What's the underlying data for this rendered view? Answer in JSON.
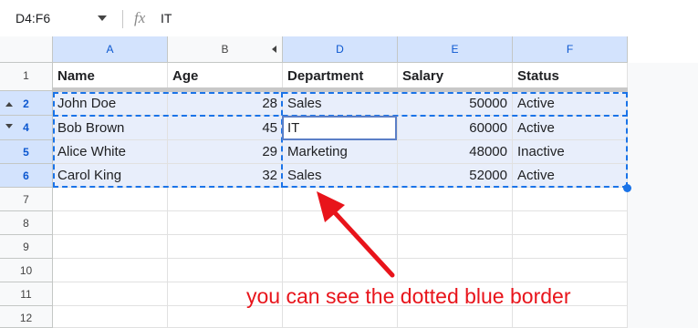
{
  "formula_bar": {
    "name_box": "D4:F6",
    "fx_label": "fx",
    "value": "IT"
  },
  "columns": [
    "A",
    "B",
    "D",
    "E",
    "F"
  ],
  "rows": [
    "1",
    "2",
    "4",
    "5",
    "6",
    "7",
    "8",
    "9",
    "10",
    "11",
    "12"
  ],
  "headers": [
    "Name",
    "Age",
    "Department",
    "Salary",
    "Status"
  ],
  "data": [
    [
      "John Doe",
      "28",
      "Sales",
      "50000",
      "Active"
    ],
    [
      "Bob Brown",
      "45",
      "IT",
      "60000",
      "Active"
    ],
    [
      "Alice White",
      "29",
      "Marketing",
      "48000",
      "Inactive"
    ],
    [
      "Carol King",
      "32",
      "Sales",
      "52000",
      "Active"
    ]
  ],
  "annotation": "you can see the dotted blue border",
  "colors": {
    "selection_blue": "#1a73e8",
    "annotation_red": "#e8141b"
  }
}
